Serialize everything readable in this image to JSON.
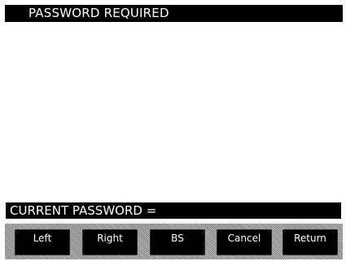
{
  "title": "PASSWORD REQUIRED",
  "input_line": "CURRENT PASSWORD =",
  "softkeys": [
    {
      "label": "Left"
    },
    {
      "label": "Right"
    },
    {
      "label": "BS"
    },
    {
      "label": "Cancel"
    },
    {
      "label": "Return"
    }
  ],
  "colors": {
    "background": "#ffffff",
    "bar": "#000000",
    "text": "#ffffff",
    "softkey_bar": "#9a9a9a"
  }
}
